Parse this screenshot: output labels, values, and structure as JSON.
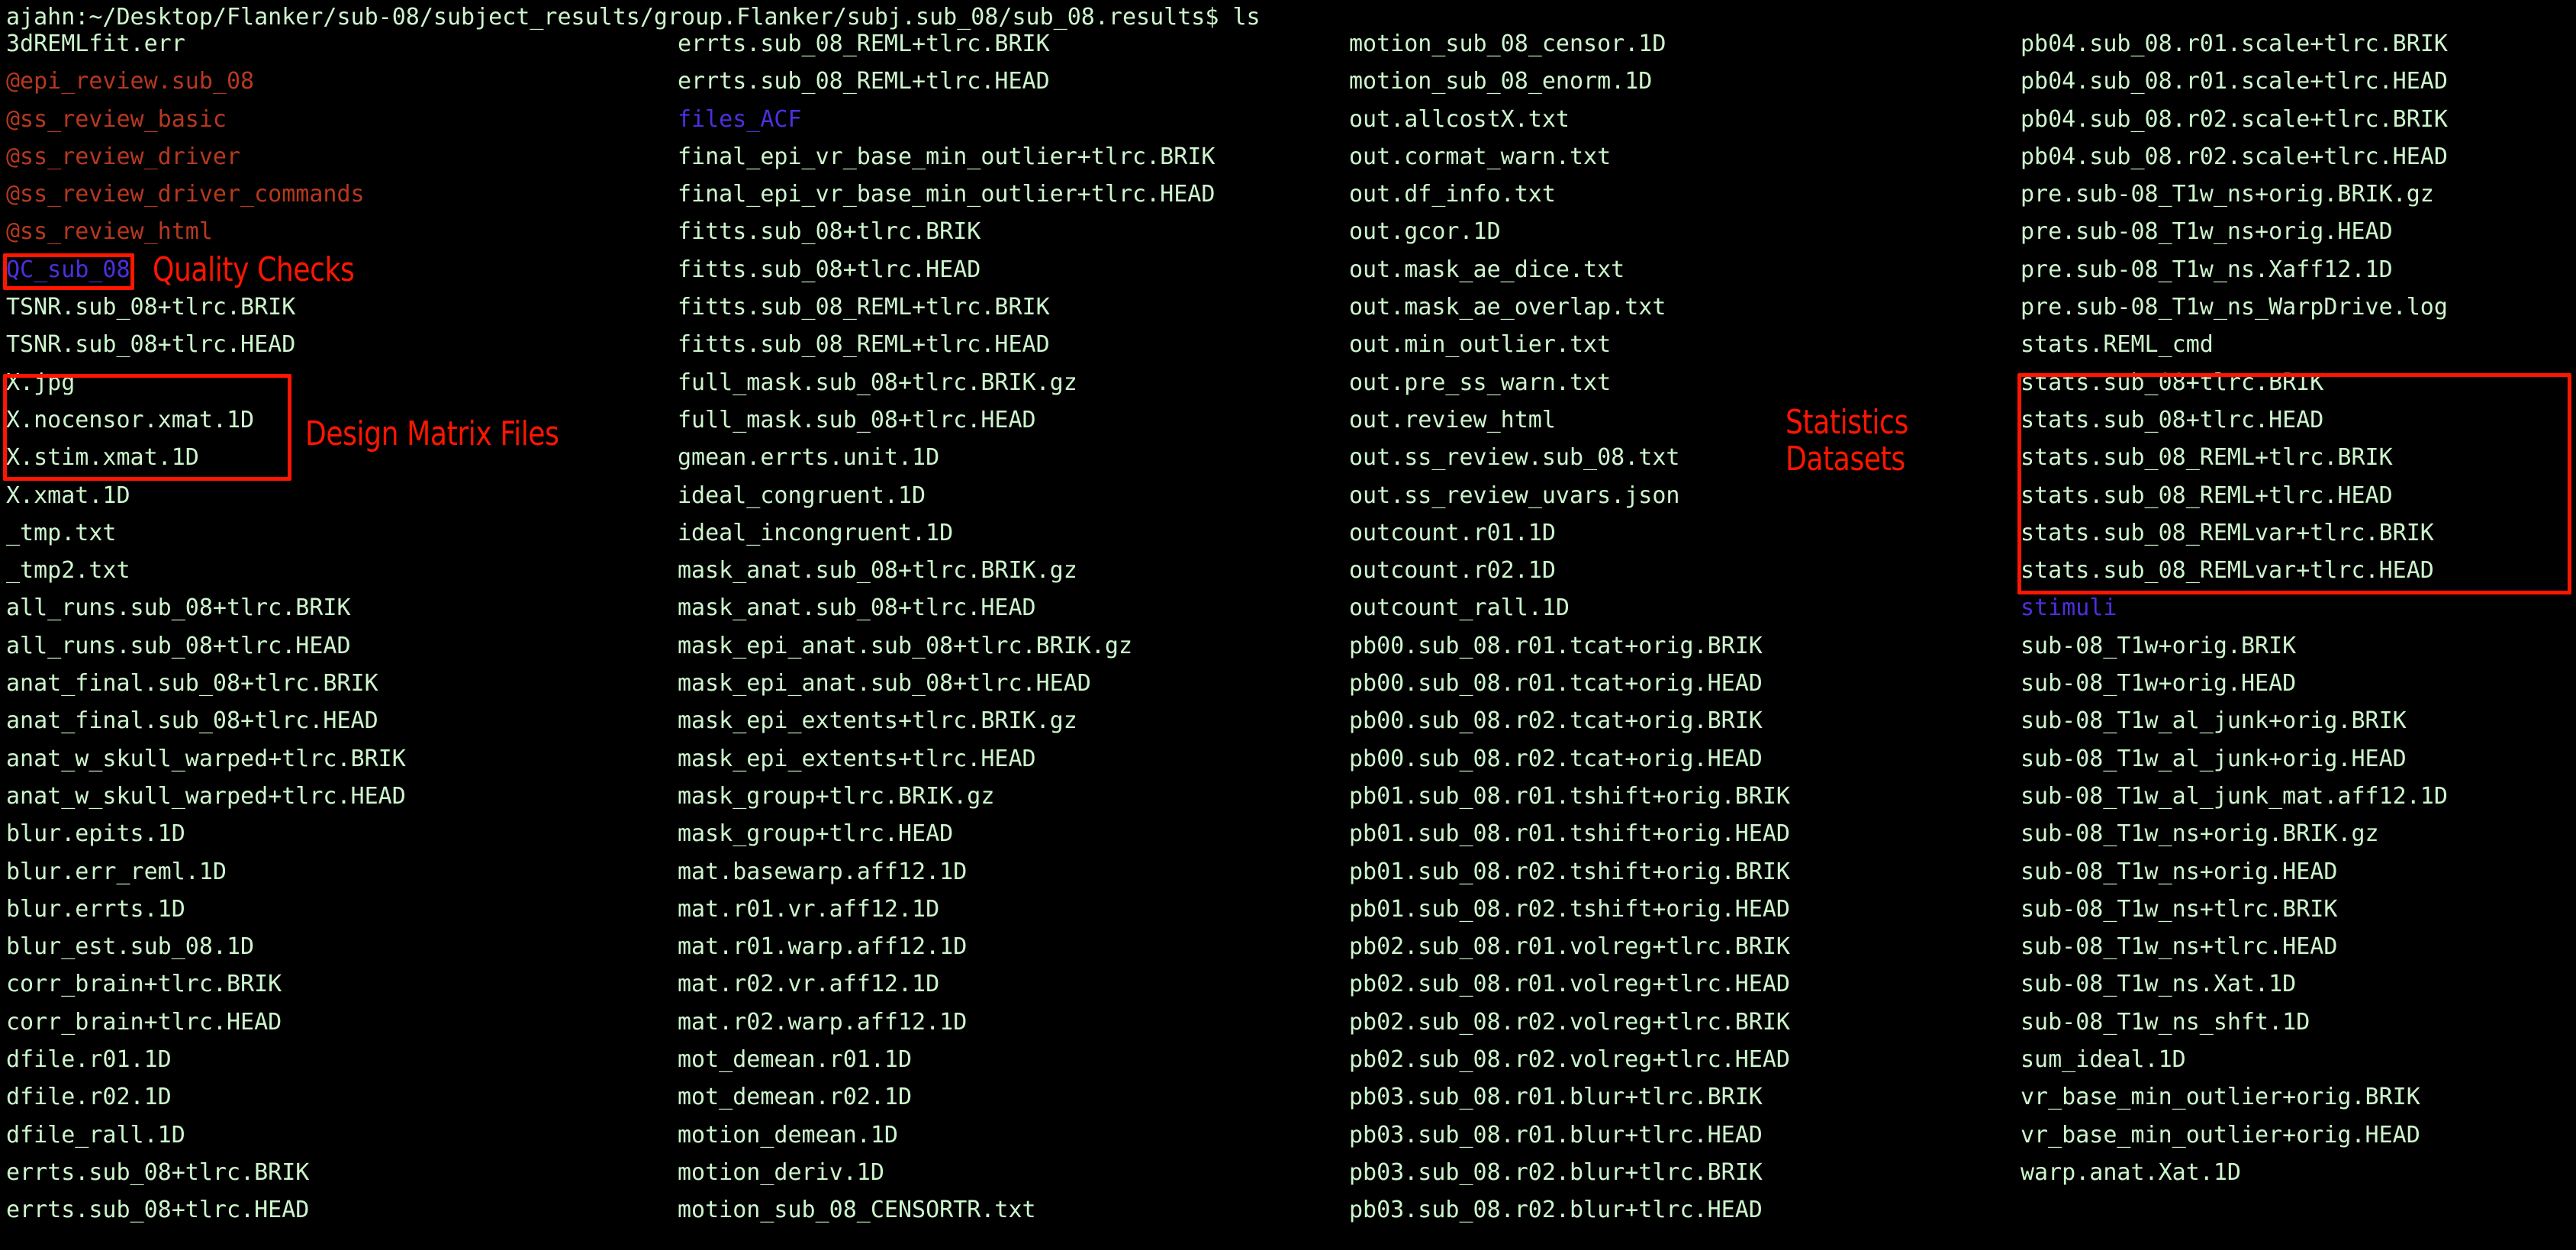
{
  "terminal": {
    "prompt": "ajahn:~/Desktop/Flanker/sub-08/subject_results/group.Flanker/subj.sub_08/sub_08.results$ ls",
    "colors": {
      "background": "#000000",
      "file": "#cdf5cd",
      "executable": "#b7381f",
      "directory": "#4b30e0",
      "annotation": "#ff1500"
    },
    "columns": [
      {
        "id": "column-1",
        "entries": [
          {
            "name": "3dREMLfit.err",
            "kind": "file"
          },
          {
            "name": "@epi_review.sub_08",
            "kind": "executable"
          },
          {
            "name": "@ss_review_basic",
            "kind": "executable"
          },
          {
            "name": "@ss_review_driver",
            "kind": "executable"
          },
          {
            "name": "@ss_review_driver_commands",
            "kind": "executable"
          },
          {
            "name": "@ss_review_html",
            "kind": "executable"
          },
          {
            "name": "QC_sub_08",
            "kind": "directory"
          },
          {
            "name": "TSNR.sub_08+tlrc.BRIK",
            "kind": "file"
          },
          {
            "name": "TSNR.sub_08+tlrc.HEAD",
            "kind": "file"
          },
          {
            "name": "X.jpg",
            "kind": "file"
          },
          {
            "name": "X.nocensor.xmat.1D",
            "kind": "file"
          },
          {
            "name": "X.stim.xmat.1D",
            "kind": "file"
          },
          {
            "name": "X.xmat.1D",
            "kind": "file"
          },
          {
            "name": "_tmp.txt",
            "kind": "file"
          },
          {
            "name": "_tmp2.txt",
            "kind": "file"
          },
          {
            "name": "all_runs.sub_08+tlrc.BRIK",
            "kind": "file"
          },
          {
            "name": "all_runs.sub_08+tlrc.HEAD",
            "kind": "file"
          },
          {
            "name": "anat_final.sub_08+tlrc.BRIK",
            "kind": "file"
          },
          {
            "name": "anat_final.sub_08+tlrc.HEAD",
            "kind": "file"
          },
          {
            "name": "anat_w_skull_warped+tlrc.BRIK",
            "kind": "file"
          },
          {
            "name": "anat_w_skull_warped+tlrc.HEAD",
            "kind": "file"
          },
          {
            "name": "blur.epits.1D",
            "kind": "file"
          },
          {
            "name": "blur.err_reml.1D",
            "kind": "file"
          },
          {
            "name": "blur.errts.1D",
            "kind": "file"
          },
          {
            "name": "blur_est.sub_08.1D",
            "kind": "file"
          },
          {
            "name": "corr_brain+tlrc.BRIK",
            "kind": "file"
          },
          {
            "name": "corr_brain+tlrc.HEAD",
            "kind": "file"
          },
          {
            "name": "dfile.r01.1D",
            "kind": "file"
          },
          {
            "name": "dfile.r02.1D",
            "kind": "file"
          },
          {
            "name": "dfile_rall.1D",
            "kind": "file"
          },
          {
            "name": "errts.sub_08+tlrc.BRIK",
            "kind": "file"
          },
          {
            "name": "errts.sub_08+tlrc.HEAD",
            "kind": "file"
          }
        ]
      },
      {
        "id": "column-2",
        "entries": [
          {
            "name": "errts.sub_08_REML+tlrc.BRIK",
            "kind": "file"
          },
          {
            "name": "errts.sub_08_REML+tlrc.HEAD",
            "kind": "file"
          },
          {
            "name": "files_ACF",
            "kind": "directory"
          },
          {
            "name": "final_epi_vr_base_min_outlier+tlrc.BRIK",
            "kind": "file"
          },
          {
            "name": "final_epi_vr_base_min_outlier+tlrc.HEAD",
            "kind": "file"
          },
          {
            "name": "fitts.sub_08+tlrc.BRIK",
            "kind": "file"
          },
          {
            "name": "fitts.sub_08+tlrc.HEAD",
            "kind": "file"
          },
          {
            "name": "fitts.sub_08_REML+tlrc.BRIK",
            "kind": "file"
          },
          {
            "name": "fitts.sub_08_REML+tlrc.HEAD",
            "kind": "file"
          },
          {
            "name": "full_mask.sub_08+tlrc.BRIK.gz",
            "kind": "file"
          },
          {
            "name": "full_mask.sub_08+tlrc.HEAD",
            "kind": "file"
          },
          {
            "name": "gmean.errts.unit.1D",
            "kind": "file"
          },
          {
            "name": "ideal_congruent.1D",
            "kind": "file"
          },
          {
            "name": "ideal_incongruent.1D",
            "kind": "file"
          },
          {
            "name": "mask_anat.sub_08+tlrc.BRIK.gz",
            "kind": "file"
          },
          {
            "name": "mask_anat.sub_08+tlrc.HEAD",
            "kind": "file"
          },
          {
            "name": "mask_epi_anat.sub_08+tlrc.BRIK.gz",
            "kind": "file"
          },
          {
            "name": "mask_epi_anat.sub_08+tlrc.HEAD",
            "kind": "file"
          },
          {
            "name": "mask_epi_extents+tlrc.BRIK.gz",
            "kind": "file"
          },
          {
            "name": "mask_epi_extents+tlrc.HEAD",
            "kind": "file"
          },
          {
            "name": "mask_group+tlrc.BRIK.gz",
            "kind": "file"
          },
          {
            "name": "mask_group+tlrc.HEAD",
            "kind": "file"
          },
          {
            "name": "mat.basewarp.aff12.1D",
            "kind": "file"
          },
          {
            "name": "mat.r01.vr.aff12.1D",
            "kind": "file"
          },
          {
            "name": "mat.r01.warp.aff12.1D",
            "kind": "file"
          },
          {
            "name": "mat.r02.vr.aff12.1D",
            "kind": "file"
          },
          {
            "name": "mat.r02.warp.aff12.1D",
            "kind": "file"
          },
          {
            "name": "mot_demean.r01.1D",
            "kind": "file"
          },
          {
            "name": "mot_demean.r02.1D",
            "kind": "file"
          },
          {
            "name": "motion_demean.1D",
            "kind": "file"
          },
          {
            "name": "motion_deriv.1D",
            "kind": "file"
          },
          {
            "name": "motion_sub_08_CENSORTR.txt",
            "kind": "file"
          }
        ]
      },
      {
        "id": "column-3",
        "entries": [
          {
            "name": "motion_sub_08_censor.1D",
            "kind": "file"
          },
          {
            "name": "motion_sub_08_enorm.1D",
            "kind": "file"
          },
          {
            "name": "out.allcostX.txt",
            "kind": "file"
          },
          {
            "name": "out.cormat_warn.txt",
            "kind": "file"
          },
          {
            "name": "out.df_info.txt",
            "kind": "file"
          },
          {
            "name": "out.gcor.1D",
            "kind": "file"
          },
          {
            "name": "out.mask_ae_dice.txt",
            "kind": "file"
          },
          {
            "name": "out.mask_ae_overlap.txt",
            "kind": "file"
          },
          {
            "name": "out.min_outlier.txt",
            "kind": "file"
          },
          {
            "name": "out.pre_ss_warn.txt",
            "kind": "file"
          },
          {
            "name": "out.review_html",
            "kind": "file"
          },
          {
            "name": "out.ss_review.sub_08.txt",
            "kind": "file"
          },
          {
            "name": "out.ss_review_uvars.json",
            "kind": "file"
          },
          {
            "name": "outcount.r01.1D",
            "kind": "file"
          },
          {
            "name": "outcount.r02.1D",
            "kind": "file"
          },
          {
            "name": "outcount_rall.1D",
            "kind": "file"
          },
          {
            "name": "pb00.sub_08.r01.tcat+orig.BRIK",
            "kind": "file"
          },
          {
            "name": "pb00.sub_08.r01.tcat+orig.HEAD",
            "kind": "file"
          },
          {
            "name": "pb00.sub_08.r02.tcat+orig.BRIK",
            "kind": "file"
          },
          {
            "name": "pb00.sub_08.r02.tcat+orig.HEAD",
            "kind": "file"
          },
          {
            "name": "pb01.sub_08.r01.tshift+orig.BRIK",
            "kind": "file"
          },
          {
            "name": "pb01.sub_08.r01.tshift+orig.HEAD",
            "kind": "file"
          },
          {
            "name": "pb01.sub_08.r02.tshift+orig.BRIK",
            "kind": "file"
          },
          {
            "name": "pb01.sub_08.r02.tshift+orig.HEAD",
            "kind": "file"
          },
          {
            "name": "pb02.sub_08.r01.volreg+tlrc.BRIK",
            "kind": "file"
          },
          {
            "name": "pb02.sub_08.r01.volreg+tlrc.HEAD",
            "kind": "file"
          },
          {
            "name": "pb02.sub_08.r02.volreg+tlrc.BRIK",
            "kind": "file"
          },
          {
            "name": "pb02.sub_08.r02.volreg+tlrc.HEAD",
            "kind": "file"
          },
          {
            "name": "pb03.sub_08.r01.blur+tlrc.BRIK",
            "kind": "file"
          },
          {
            "name": "pb03.sub_08.r01.blur+tlrc.HEAD",
            "kind": "file"
          },
          {
            "name": "pb03.sub_08.r02.blur+tlrc.BRIK",
            "kind": "file"
          },
          {
            "name": "pb03.sub_08.r02.blur+tlrc.HEAD",
            "kind": "file"
          }
        ]
      },
      {
        "id": "column-4",
        "entries": [
          {
            "name": "pb04.sub_08.r01.scale+tlrc.BRIK",
            "kind": "file"
          },
          {
            "name": "pb04.sub_08.r01.scale+tlrc.HEAD",
            "kind": "file"
          },
          {
            "name": "pb04.sub_08.r02.scale+tlrc.BRIK",
            "kind": "file"
          },
          {
            "name": "pb04.sub_08.r02.scale+tlrc.HEAD",
            "kind": "file"
          },
          {
            "name": "pre.sub-08_T1w_ns+orig.BRIK.gz",
            "kind": "file"
          },
          {
            "name": "pre.sub-08_T1w_ns+orig.HEAD",
            "kind": "file"
          },
          {
            "name": "pre.sub-08_T1w_ns.Xaff12.1D",
            "kind": "file"
          },
          {
            "name": "pre.sub-08_T1w_ns_WarpDrive.log",
            "kind": "file"
          },
          {
            "name": "stats.REML_cmd",
            "kind": "file"
          },
          {
            "name": "stats.sub_08+tlrc.BRIK",
            "kind": "file"
          },
          {
            "name": "stats.sub_08+tlrc.HEAD",
            "kind": "file"
          },
          {
            "name": "stats.sub_08_REML+tlrc.BRIK",
            "kind": "file"
          },
          {
            "name": "stats.sub_08_REML+tlrc.HEAD",
            "kind": "file"
          },
          {
            "name": "stats.sub_08_REMLvar+tlrc.BRIK",
            "kind": "file"
          },
          {
            "name": "stats.sub_08_REMLvar+tlrc.HEAD",
            "kind": "file"
          },
          {
            "name": "stimuli",
            "kind": "directory"
          },
          {
            "name": "sub-08_T1w+orig.BRIK",
            "kind": "file"
          },
          {
            "name": "sub-08_T1w+orig.HEAD",
            "kind": "file"
          },
          {
            "name": "sub-08_T1w_al_junk+orig.BRIK",
            "kind": "file"
          },
          {
            "name": "sub-08_T1w_al_junk+orig.HEAD",
            "kind": "file"
          },
          {
            "name": "sub-08_T1w_al_junk_mat.aff12.1D",
            "kind": "file"
          },
          {
            "name": "sub-08_T1w_ns+orig.BRIK.gz",
            "kind": "file"
          },
          {
            "name": "sub-08_T1w_ns+orig.HEAD",
            "kind": "file"
          },
          {
            "name": "sub-08_T1w_ns+tlrc.BRIK",
            "kind": "file"
          },
          {
            "name": "sub-08_T1w_ns+tlrc.HEAD",
            "kind": "file"
          },
          {
            "name": "sub-08_T1w_ns.Xat.1D",
            "kind": "file"
          },
          {
            "name": "sub-08_T1w_ns_shft.1D",
            "kind": "file"
          },
          {
            "name": "sum_ideal.1D",
            "kind": "file"
          },
          {
            "name": "vr_base_min_outlier+orig.BRIK",
            "kind": "file"
          },
          {
            "name": "vr_base_min_outlier+orig.HEAD",
            "kind": "file"
          },
          {
            "name": "warp.anat.Xat.1D",
            "kind": "file"
          }
        ]
      }
    ]
  },
  "annotations": {
    "quality_checks": "Quality Checks",
    "design_matrix": "Design Matrix Files",
    "statistics_line1": "Statistics",
    "statistics_line2": "Datasets"
  }
}
